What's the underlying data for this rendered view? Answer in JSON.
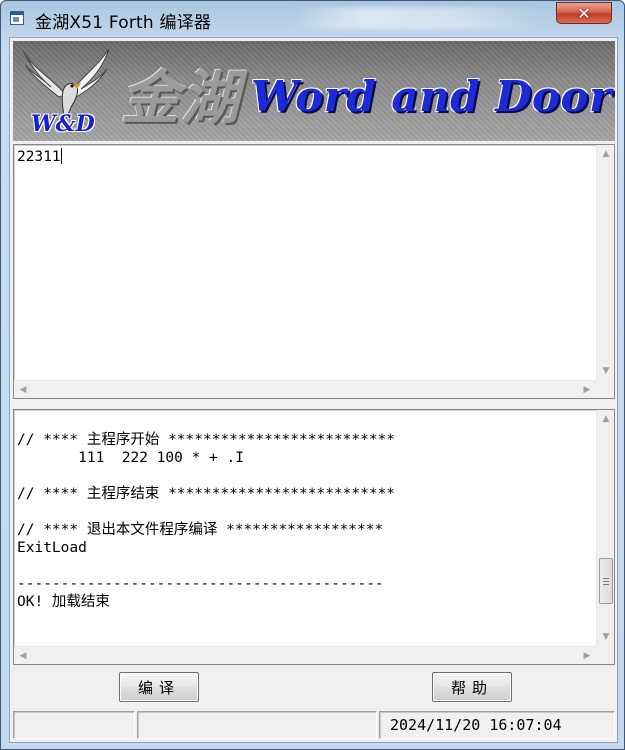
{
  "window": {
    "title": "金湖X51 Forth 编译器",
    "close_glyph": "✕"
  },
  "banner": {
    "wd_logo": "W&D",
    "chinese_logo": "金湖",
    "brand_text": "Word and Door 计算机"
  },
  "editor": {
    "text": "22311"
  },
  "output": {
    "lines": [
      "",
      "// **** 主程序开始 **************************",
      "       111  222 100 * + .I",
      "",
      "// **** 主程序结束 **************************",
      "",
      "// **** 退出本文件程序编译 ******************",
      "ExitLoad",
      "",
      "------------------------------------------",
      "OK! 加载结束"
    ]
  },
  "buttons": {
    "compile_label": "编译",
    "help_label": "帮助"
  },
  "statusbar": {
    "pane1": "",
    "pane2": "",
    "datetime": "2024/11/20 16:07:04"
  },
  "icons": {
    "app": "app-window-icon",
    "close": "close-icon",
    "scroll_up": "arrow-up-icon",
    "scroll_down": "arrow-down-icon",
    "scroll_left": "arrow-left-icon",
    "scroll_right": "arrow-right-icon"
  },
  "colors": {
    "brand_blue": "#1c2bd8",
    "close_red": "#c23a22"
  }
}
